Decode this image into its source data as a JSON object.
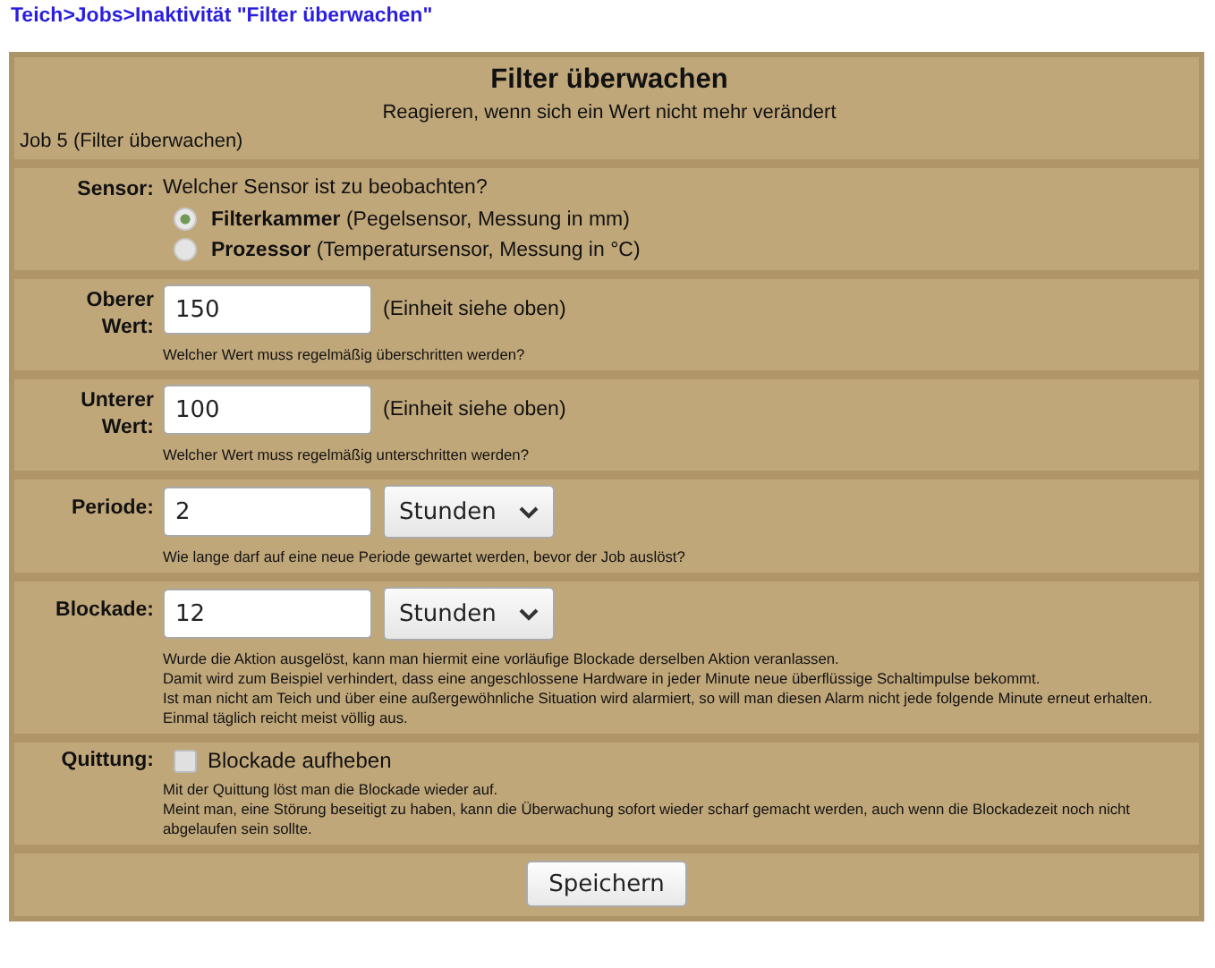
{
  "breadcrumb": {
    "separator": ">",
    "items": [
      {
        "label": "Teich"
      },
      {
        "label": "Jobs"
      },
      {
        "label": "Inaktivität \"Filter überwachen\""
      }
    ]
  },
  "header": {
    "title": "Filter überwachen",
    "subtitle": "Reagieren, wenn sich ein Wert nicht mehr verändert",
    "job": "Job 5 (Filter überwachen)"
  },
  "sections": [
    {
      "kind": "radio",
      "label": "Sensor:",
      "question": "Welcher Sensor ist zu beobachten?",
      "options": [
        {
          "name": "Filterkammer",
          "detail": "(Pegelsensor, Messung in mm)",
          "selected": true
        },
        {
          "name": "Prozessor",
          "detail": "(Temperatursensor, Messung in °C)",
          "selected": false
        }
      ]
    },
    {
      "kind": "input",
      "label": "Oberer Wert:",
      "value": "150",
      "unit": "(Einheit siehe oben)",
      "hint": [
        "Welcher Wert muss regelmäßig überschritten werden?"
      ]
    },
    {
      "kind": "input",
      "label": "Unterer Wert:",
      "value": "100",
      "unit": "(Einheit siehe oben)",
      "hint": [
        "Welcher Wert muss regelmäßig unterschritten werden?"
      ]
    },
    {
      "kind": "select",
      "label": "Periode:",
      "value": "2",
      "option": "Stunden",
      "hint": [
        "Wie lange darf auf eine neue Periode gewartet werden, bevor der Job auslöst?"
      ]
    },
    {
      "kind": "select",
      "label": "Blockade:",
      "value": "12",
      "option": "Stunden",
      "hint": [
        "Wurde die Aktion ausgelöst, kann man hiermit eine vorläufige Blockade derselben Aktion veranlassen.",
        "Damit wird zum Beispiel verhindert, dass eine angeschlossene Hardware in jeder Minute neue überflüssige Schaltimpulse bekommt.",
        "Ist man nicht am Teich und über eine außergewöhnliche Situation wird alarmiert, so will man diesen Alarm nicht jede folgende Minute erneut erhalten. Einmal täglich reicht meist völlig aus."
      ]
    },
    {
      "kind": "checkbox",
      "label": "Quittung:",
      "text": "Blockade aufheben",
      "checked": false,
      "hint": [
        "Mit der Quittung löst man die Blockade wieder auf.",
        "Meint man, eine Störung beseitigt zu haben, kann die Überwachung sofort wieder scharf gemacht werden, auch wenn die Blockadezeit noch nicht abgelaufen sein sollte."
      ]
    }
  ],
  "save_button": "Speichern"
}
